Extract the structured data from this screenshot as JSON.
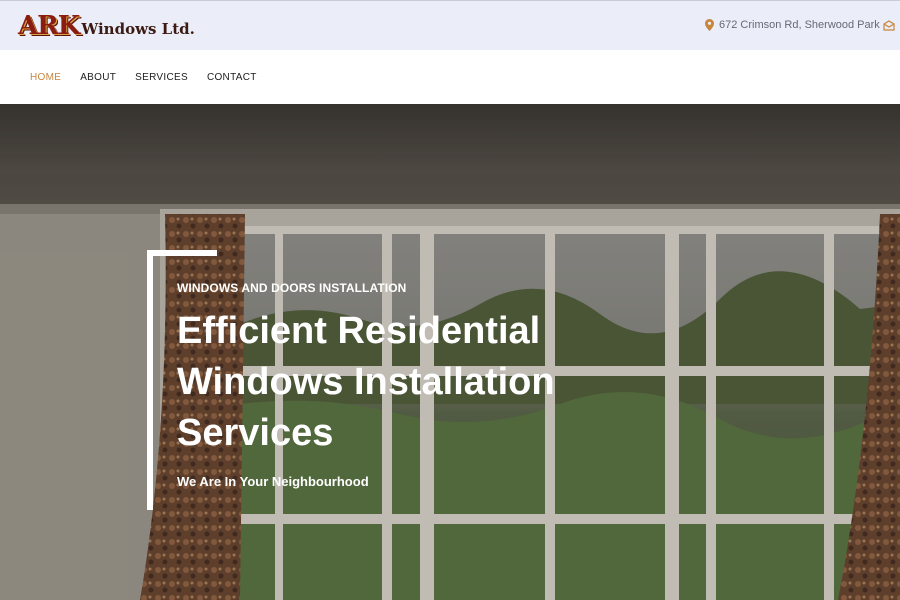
{
  "logo": {
    "brand": "ARK",
    "rest": "Windows Ltd."
  },
  "topbar": {
    "address": "672 Crimson Rd, Sherwood Park"
  },
  "nav": {
    "items": [
      {
        "label": "HOME",
        "active": true
      },
      {
        "label": "ABOUT",
        "active": false
      },
      {
        "label": "SERVICES",
        "active": false
      },
      {
        "label": "CONTACT",
        "active": false
      }
    ]
  },
  "hero": {
    "eyebrow": "WINDOWS AND DOORS INSTALLATION",
    "headline_lines": [
      "Efficient Residential",
      "Windows Installation",
      "Services"
    ],
    "subline": "We Are In Your Neighbourhood"
  },
  "colors": {
    "accent": "#c8853c",
    "topbar_bg": "#ebeef9",
    "logo_red": "#8b1c12"
  },
  "icons": {
    "address": "map-pin-icon",
    "email": "envelope-icon"
  }
}
